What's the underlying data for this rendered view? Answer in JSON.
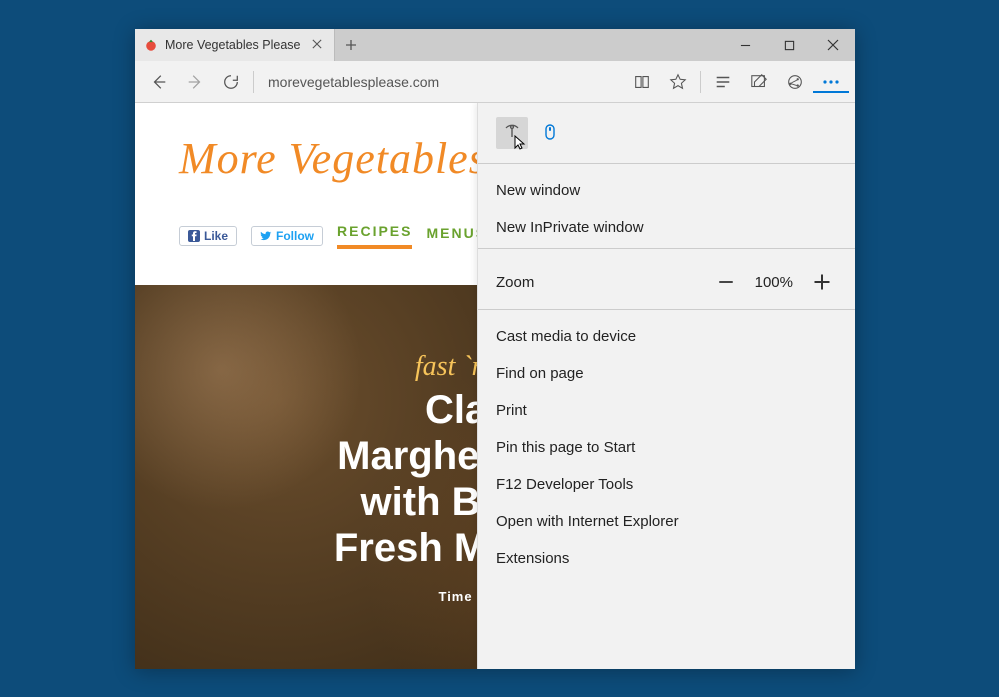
{
  "tab": {
    "title": "More Vegetables Please",
    "favicon": "tomato-icon"
  },
  "toolbar": {
    "url": "morevegetablesplease.com"
  },
  "site": {
    "title": "More Vegetables Please",
    "fb": "Like",
    "tw": "Follow",
    "nav": [
      "RECIPES",
      "MENUS"
    ]
  },
  "hero": {
    "tag": "fast `n healthy",
    "title": "Classic\nMargherita Pizza\nwith Basil and\nFresh Mozzarella",
    "sub": "Time to Prepare"
  },
  "menu": {
    "new_window": "New window",
    "inprivate": "New InPrivate window",
    "zoom_label": "Zoom",
    "zoom_value": "100%",
    "cast": "Cast media to device",
    "find": "Find on page",
    "print": "Print",
    "pin": "Pin this page to Start",
    "devtools": "F12 Developer Tools",
    "open_ie": "Open with Internet Explorer",
    "extensions": "Extensions"
  }
}
